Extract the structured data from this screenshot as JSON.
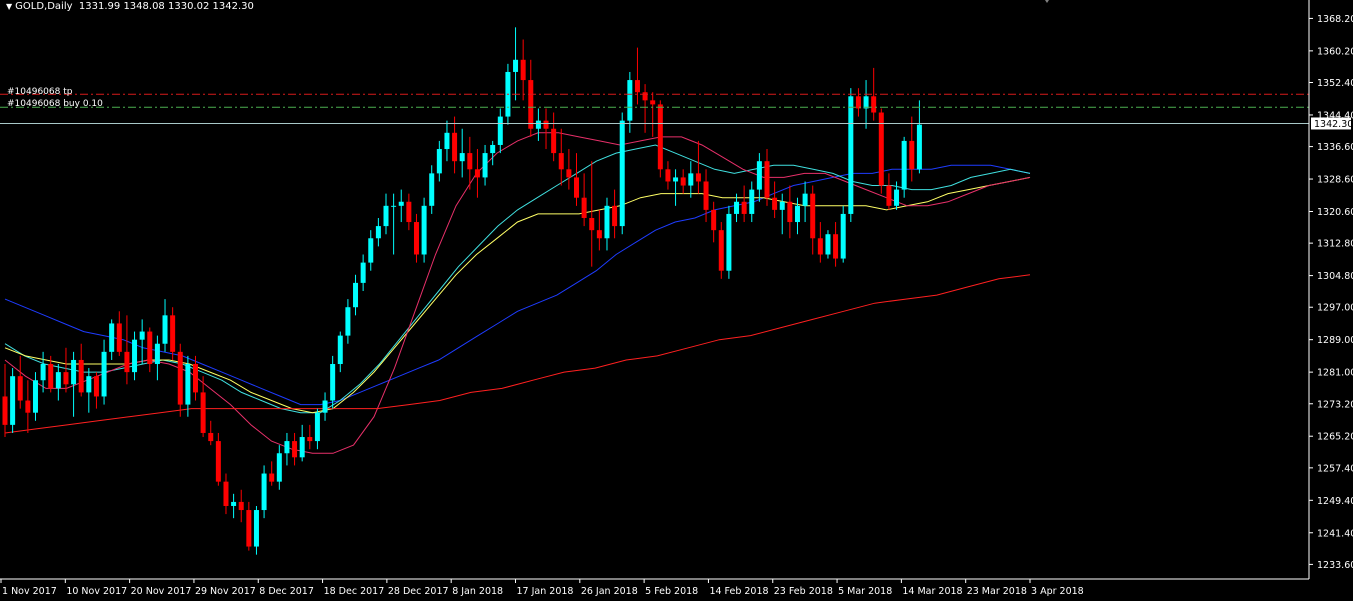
{
  "header": {
    "symbol_timeframe": "GOLD,Daily",
    "open": "1331.99",
    "high": "1348.08",
    "low": "1330.02",
    "close": "1342.30"
  },
  "orders": {
    "tp_label": "#10496068 tp",
    "buy_label": "#10496068 buy 0.10",
    "tp_price": 1349.5,
    "entry_price": 1346.3
  },
  "current_price_label": "1342.30",
  "colors": {
    "background": "#000000",
    "bull_candle": "#00ffff",
    "bear_candle": "#ff0000",
    "grid_axis": "#ffffff",
    "ma_blue": "#1e3cff",
    "ma_aqua": "#40e0e0",
    "ma_yellow": "#ffff66",
    "ma_pink": "#e8306a",
    "ma_red": "#ff2020",
    "tp_line": "#d81b1b",
    "entry_line": "#4caf50"
  },
  "chart_data": {
    "type": "candlestick",
    "ylim": [
      1230.0,
      1372.0
    ],
    "yticks": [
      "1368.20",
      "1360.20",
      "1352.40",
      "1344.40",
      "1336.60",
      "1328.60",
      "1320.60",
      "1312.80",
      "1304.80",
      "1297.00",
      "1289.00",
      "1281.00",
      "1273.20",
      "1265.20",
      "1257.40",
      "1249.40",
      "1241.40",
      "1233.60"
    ],
    "xticks": [
      "1 Nov 2017",
      "10 Nov 2017",
      "20 Nov 2017",
      "29 Nov 2017",
      "8 Dec 2017",
      "18 Dec 2017",
      "28 Dec 2017",
      "8 Jan 2018",
      "17 Jan 2018",
      "26 Jan 2018",
      "5 Feb 2018",
      "14 Feb 2018",
      "23 Feb 2018",
      "5 Mar 2018",
      "14 Mar 2018",
      "23 Mar 2018",
      "3 Apr 2018"
    ],
    "candles_ohlc": [
      [
        1275,
        1283,
        1265,
        1268
      ],
      [
        1268,
        1282,
        1266,
        1280
      ],
      [
        1280,
        1285,
        1272,
        1274
      ],
      [
        1274,
        1279,
        1266,
        1271
      ],
      [
        1271,
        1281,
        1269,
        1279
      ],
      [
        1279,
        1286,
        1276,
        1283
      ],
      [
        1283,
        1285,
        1276,
        1277
      ],
      [
        1277,
        1283,
        1274,
        1281
      ],
      [
        1281,
        1287,
        1276,
        1278
      ],
      [
        1278,
        1286,
        1270,
        1284
      ],
      [
        1284,
        1288,
        1275,
        1276
      ],
      [
        1276,
        1282,
        1271,
        1280
      ],
      [
        1280,
        1281,
        1272,
        1275
      ],
      [
        1275,
        1289,
        1273,
        1286
      ],
      [
        1286,
        1294,
        1284,
        1293
      ],
      [
        1293,
        1296,
        1285,
        1286
      ],
      [
        1286,
        1295,
        1278,
        1281
      ],
      [
        1281,
        1291,
        1279,
        1289
      ],
      [
        1289,
        1294,
        1283,
        1291
      ],
      [
        1291,
        1292,
        1281,
        1283
      ],
      [
        1283,
        1290,
        1279,
        1288
      ],
      [
        1288,
        1299,
        1286,
        1295
      ],
      [
        1295,
        1297,
        1284,
        1286
      ],
      [
        1286,
        1288,
        1270,
        1273
      ],
      [
        1273,
        1285,
        1270,
        1283
      ],
      [
        1283,
        1285,
        1274,
        1276
      ],
      [
        1276,
        1280,
        1265,
        1266
      ],
      [
        1266,
        1269,
        1263,
        1264
      ],
      [
        1264,
        1266,
        1253,
        1254
      ],
      [
        1254,
        1256,
        1246,
        1248
      ],
      [
        1248,
        1251,
        1245,
        1249
      ],
      [
        1249,
        1252,
        1244,
        1247
      ],
      [
        1247,
        1249,
        1237,
        1238
      ],
      [
        1238,
        1248,
        1236,
        1247
      ],
      [
        1247,
        1258,
        1245,
        1256
      ],
      [
        1256,
        1259,
        1253,
        1254
      ],
      [
        1254,
        1263,
        1252,
        1261
      ],
      [
        1261,
        1266,
        1258,
        1264
      ],
      [
        1264,
        1266,
        1258,
        1260
      ],
      [
        1260,
        1268,
        1259,
        1265
      ],
      [
        1265,
        1268,
        1262,
        1264
      ],
      [
        1264,
        1272,
        1262,
        1271
      ],
      [
        1271,
        1276,
        1269,
        1274
      ],
      [
        1274,
        1285,
        1272,
        1283
      ],
      [
        1283,
        1291,
        1281,
        1290
      ],
      [
        1290,
        1299,
        1288,
        1297
      ],
      [
        1297,
        1305,
        1295,
        1303
      ],
      [
        1303,
        1310,
        1301,
        1308
      ],
      [
        1308,
        1316,
        1306,
        1314
      ],
      [
        1314,
        1319,
        1312,
        1317
      ],
      [
        1317,
        1325,
        1315,
        1322
      ],
      [
        1322,
        1325,
        1310,
        1322
      ],
      [
        1322,
        1326,
        1318,
        1323
      ],
      [
        1323,
        1325,
        1316,
        1318
      ],
      [
        1318,
        1320,
        1308,
        1310
      ],
      [
        1310,
        1324,
        1308,
        1322
      ],
      [
        1322,
        1332,
        1320,
        1330
      ],
      [
        1330,
        1338,
        1328,
        1336
      ],
      [
        1336,
        1343,
        1333,
        1340
      ],
      [
        1340,
        1344,
        1330,
        1333
      ],
      [
        1333,
        1341,
        1329,
        1335
      ],
      [
        1335,
        1339,
        1326,
        1331
      ],
      [
        1331,
        1336,
        1324,
        1329
      ],
      [
        1329,
        1337,
        1327,
        1335
      ],
      [
        1335,
        1338,
        1332,
        1337
      ],
      [
        1337,
        1346,
        1335,
        1344
      ],
      [
        1344,
        1357,
        1342,
        1355
      ],
      [
        1355,
        1366,
        1348,
        1358
      ],
      [
        1358,
        1363,
        1348,
        1353
      ],
      [
        1353,
        1358,
        1339,
        1341
      ],
      [
        1341,
        1346,
        1338,
        1343
      ],
      [
        1343,
        1346,
        1336,
        1341
      ],
      [
        1341,
        1345,
        1333,
        1335
      ],
      [
        1335,
        1341,
        1327,
        1331
      ],
      [
        1331,
        1336,
        1326,
        1329
      ],
      [
        1329,
        1335,
        1322,
        1324
      ],
      [
        1324,
        1330,
        1317,
        1319
      ],
      [
        1319,
        1333,
        1307,
        1316
      ],
      [
        1316,
        1321,
        1311,
        1314
      ],
      [
        1314,
        1324,
        1311,
        1322
      ],
      [
        1322,
        1326,
        1314,
        1317
      ],
      [
        1317,
        1345,
        1315,
        1343
      ],
      [
        1343,
        1355,
        1340,
        1353
      ],
      [
        1353,
        1361,
        1347,
        1350
      ],
      [
        1350,
        1352,
        1340,
        1348
      ],
      [
        1348,
        1350,
        1339,
        1347
      ],
      [
        1347,
        1348,
        1329,
        1331
      ],
      [
        1331,
        1333,
        1326,
        1328
      ],
      [
        1328,
        1331,
        1322,
        1329
      ],
      [
        1329,
        1331,
        1325,
        1327
      ],
      [
        1327,
        1333,
        1324,
        1330
      ],
      [
        1330,
        1338,
        1325,
        1328
      ],
      [
        1328,
        1331,
        1318,
        1321
      ],
      [
        1321,
        1323,
        1313,
        1316
      ],
      [
        1316,
        1318,
        1304,
        1306
      ],
      [
        1306,
        1322,
        1304,
        1320
      ],
      [
        1320,
        1325,
        1318,
        1323
      ],
      [
        1323,
        1327,
        1318,
        1320
      ],
      [
        1320,
        1328,
        1318,
        1326
      ],
      [
        1326,
        1335,
        1323,
        1333
      ],
      [
        1333,
        1336,
        1322,
        1324
      ],
      [
        1324,
        1328,
        1319,
        1321
      ],
      [
        1321,
        1325,
        1315,
        1323
      ],
      [
        1323,
        1327,
        1314,
        1318
      ],
      [
        1318,
        1324,
        1315,
        1322
      ],
      [
        1322,
        1328,
        1318,
        1325
      ],
      [
        1325,
        1327,
        1310,
        1314
      ],
      [
        1314,
        1318,
        1308,
        1310
      ],
      [
        1310,
        1316,
        1309,
        1315
      ],
      [
        1315,
        1318,
        1307,
        1309
      ],
      [
        1309,
        1322,
        1308,
        1320
      ],
      [
        1320,
        1351,
        1318,
        1349
      ],
      [
        1349,
        1351,
        1344,
        1346
      ],
      [
        1346,
        1353,
        1341,
        1349
      ],
      [
        1349,
        1356,
        1343,
        1345
      ],
      [
        1345,
        1346,
        1325,
        1327
      ],
      [
        1327,
        1330,
        1321,
        1322
      ],
      [
        1322,
        1328,
        1321,
        1326
      ],
      [
        1326,
        1339,
        1324,
        1338
      ],
      [
        1338,
        1344,
        1328,
        1331
      ],
      [
        1331,
        1348,
        1330,
        1342
      ]
    ],
    "moving_averages": [
      {
        "color": "ma_blue",
        "values": [
          1299,
          1297,
          1295,
          1293,
          1291,
          1290,
          1289,
          1287,
          1286,
          1285,
          1283,
          1281,
          1279,
          1277,
          1275,
          1273,
          1273,
          1274,
          1276,
          1278,
          1280,
          1282,
          1284,
          1287,
          1290,
          1293,
          1296,
          1298,
          1300,
          1303,
          1306,
          1310,
          1313,
          1316,
          1318,
          1319,
          1321,
          1322,
          1323,
          1325,
          1327,
          1328,
          1329,
          1330,
          1330,
          1331,
          1331,
          1331,
          1332,
          1332,
          1332,
          1331,
          1330
        ]
      },
      {
        "color": "ma_aqua",
        "values": [
          1288,
          1285,
          1283,
          1282,
          1281,
          1281,
          1282,
          1283,
          1284,
          1283,
          1281,
          1279,
          1276,
          1274,
          1272,
          1271,
          1271,
          1274,
          1278,
          1283,
          1289,
          1295,
          1301,
          1307,
          1312,
          1317,
          1321,
          1324,
          1327,
          1330,
          1333,
          1335,
          1336,
          1337,
          1335,
          1333,
          1331,
          1330,
          1331,
          1332,
          1332,
          1331,
          1330,
          1328,
          1327,
          1327,
          1326,
          1326,
          1327,
          1329,
          1330,
          1331,
          1330
        ]
      },
      {
        "color": "ma_yellow",
        "values": [
          1287,
          1285,
          1284,
          1283,
          1283,
          1283,
          1283,
          1284,
          1284,
          1283,
          1281,
          1279,
          1276,
          1274,
          1272,
          1271,
          1272,
          1276,
          1281,
          1287,
          1293,
          1299,
          1305,
          1310,
          1314,
          1318,
          1320,
          1320,
          1320,
          1321,
          1322,
          1324,
          1325,
          1325,
          1325,
          1324,
          1324,
          1324,
          1323,
          1322,
          1322,
          1322,
          1322,
          1321,
          1322,
          1323,
          1325,
          1326,
          1327,
          1328,
          1329
        ]
      },
      {
        "color": "ma_pink",
        "values": [
          1284,
          1280,
          1277,
          1277,
          1279,
          1281,
          1283,
          1284,
          1283,
          1281,
          1277,
          1273,
          1268,
          1264,
          1262,
          1261,
          1261,
          1263,
          1270,
          1282,
          1296,
          1310,
          1322,
          1330,
          1335,
          1338,
          1340,
          1340,
          1339,
          1338,
          1337,
          1338,
          1339,
          1339,
          1337,
          1334,
          1331,
          1329,
          1329,
          1330,
          1330,
          1328,
          1326,
          1324,
          1322,
          1322,
          1323,
          1325,
          1327,
          1328,
          1329
        ]
      },
      {
        "color": "ma_red",
        "values": [
          1266,
          1267,
          1268,
          1269,
          1270,
          1271,
          1272,
          1272,
          1272,
          1272,
          1272,
          1272,
          1272,
          1273,
          1274,
          1276,
          1277,
          1279,
          1281,
          1282,
          1284,
          1285,
          1287,
          1289,
          1290,
          1292,
          1294,
          1296,
          1298,
          1299,
          1300,
          1302,
          1304,
          1305
        ]
      }
    ]
  }
}
